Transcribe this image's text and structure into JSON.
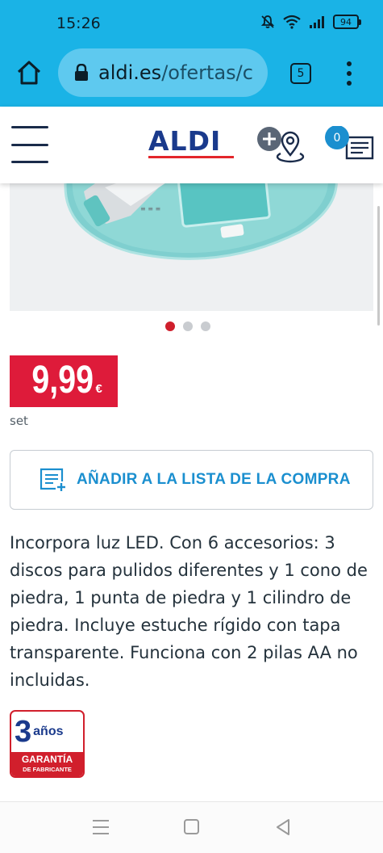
{
  "status_bar": {
    "time": "15:26",
    "battery": "94"
  },
  "browser": {
    "url_domain": "aldi.es",
    "url_path": "/ofertas/c",
    "tab_count": "5"
  },
  "site_header": {
    "logo_text": "ALDI",
    "cart_count": "0"
  },
  "carousel": {
    "total": 3,
    "active": 1
  },
  "product": {
    "price": "9,99",
    "currency": "€",
    "unit": "set",
    "add_to_list_label": "AÑADIR A LA LISTA DE LA COMPRA",
    "description": "Incorpora luz LED. Con 6 accesorios: 3 discos para pulidos diferentes y 1 cono de piedra, 1 punta de piedra y 1 cilindro de piedra. Incluye estuche rígido con tapa transparente. Funciona con 2 pilas AA no incluidas.",
    "warranty": {
      "number": "3",
      "years": "años",
      "line1": "GARANTÍA",
      "line2": "DE FABRICANTE"
    }
  },
  "colors": {
    "status_bar": "#1ab3e6",
    "price_badge": "#de1b3a",
    "accent_blue": "#1b8fcf",
    "aldi_navy": "#1a3a8c",
    "aldi_red": "#e3262b"
  }
}
